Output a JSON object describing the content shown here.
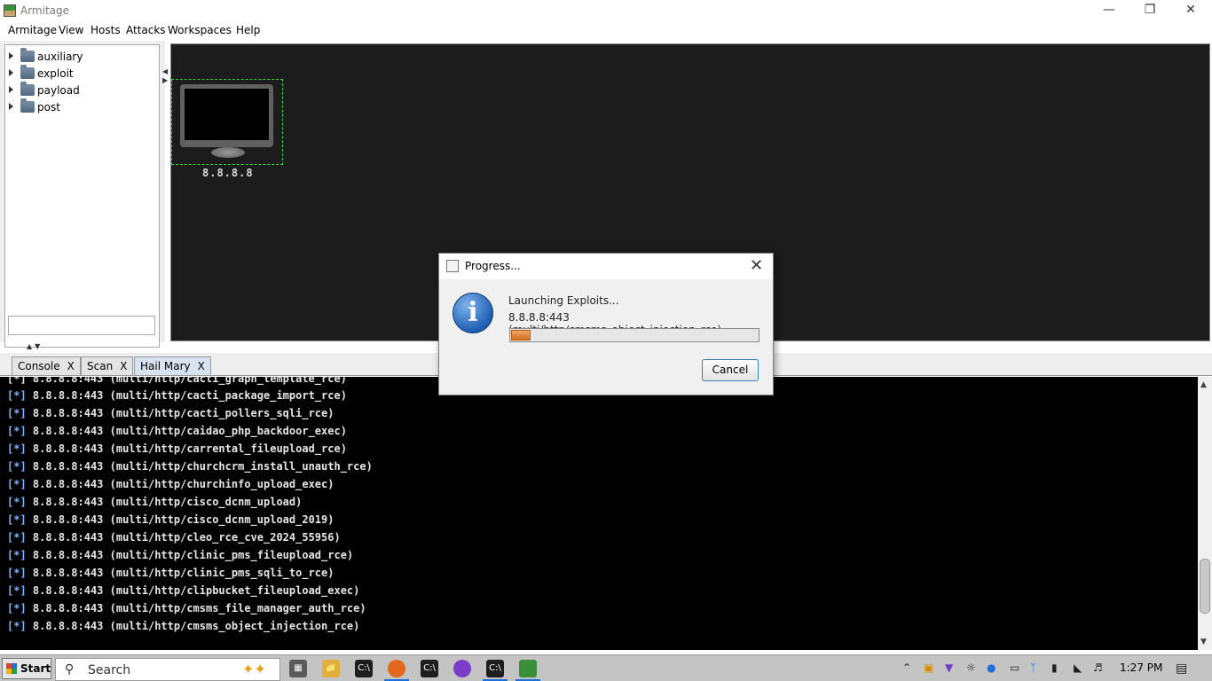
{
  "window": {
    "title": "Armitage"
  },
  "menu": [
    "Armitage",
    "View",
    "Hosts",
    "Attacks",
    "Workspaces",
    "Help"
  ],
  "modules": [
    "auxiliary",
    "exploit",
    "payload",
    "post"
  ],
  "module_search": {
    "value": ""
  },
  "targets": [
    {
      "label": "8.8.8.8"
    }
  ],
  "tabs": [
    {
      "label": "Console",
      "close": "X"
    },
    {
      "label": "Scan",
      "close": "X"
    },
    {
      "label": "Hail Mary",
      "close": "X"
    }
  ],
  "console": {
    "partial_line": "[*] 8.8.8.8:443 (multi/http/cacti_graph_template_rce)",
    "tag": "[*]",
    "lines": [
      "8.8.8.8:443 (multi/http/cacti_package_import_rce)",
      "8.8.8.8:443 (multi/http/cacti_pollers_sqli_rce)",
      "8.8.8.8:443 (multi/http/caidao_php_backdoor_exec)",
      "8.8.8.8:443 (multi/http/carrental_fileupload_rce)",
      "8.8.8.8:443 (multi/http/churchcrm_install_unauth_rce)",
      "8.8.8.8:443 (multi/http/churchinfo_upload_exec)",
      "8.8.8.8:443 (multi/http/cisco_dcnm_upload)",
      "8.8.8.8:443 (multi/http/cisco_dcnm_upload_2019)",
      "8.8.8.8:443 (multi/http/cleo_rce_cve_2024_55956)",
      "8.8.8.8:443 (multi/http/clinic_pms_fileupload_rce)",
      "8.8.8.8:443 (multi/http/clinic_pms_sqli_to_rce)",
      "8.8.8.8:443 (multi/http/clipbucket_fileupload_exec)",
      "8.8.8.8:443 (multi/http/cmsms_file_manager_auth_rce)",
      "8.8.8.8:443 (multi/http/cmsms_object_injection_rce)"
    ]
  },
  "dialog": {
    "title": "Progress...",
    "message": "Launching Exploits...",
    "detail": "8.8.8.8:443 (multi/http/cmsms_object_injection_rce)",
    "progress": 0.08,
    "cancel_label": "Cancel",
    "icon": "info-icon"
  },
  "taskbar": {
    "start_label": "Start",
    "search_placeholder": "Search",
    "apps": [
      "task-view-icon",
      "file-explorer-icon",
      "terminal-icon",
      "firefox-icon",
      "terminal-icon",
      "tor-browser-icon",
      "terminal-icon",
      "armitage-icon"
    ],
    "clock": "1:27 PM"
  },
  "colors": {
    "accent": "#1e6fd9",
    "selection": "#3ad13a",
    "progress": "#d7701e"
  }
}
